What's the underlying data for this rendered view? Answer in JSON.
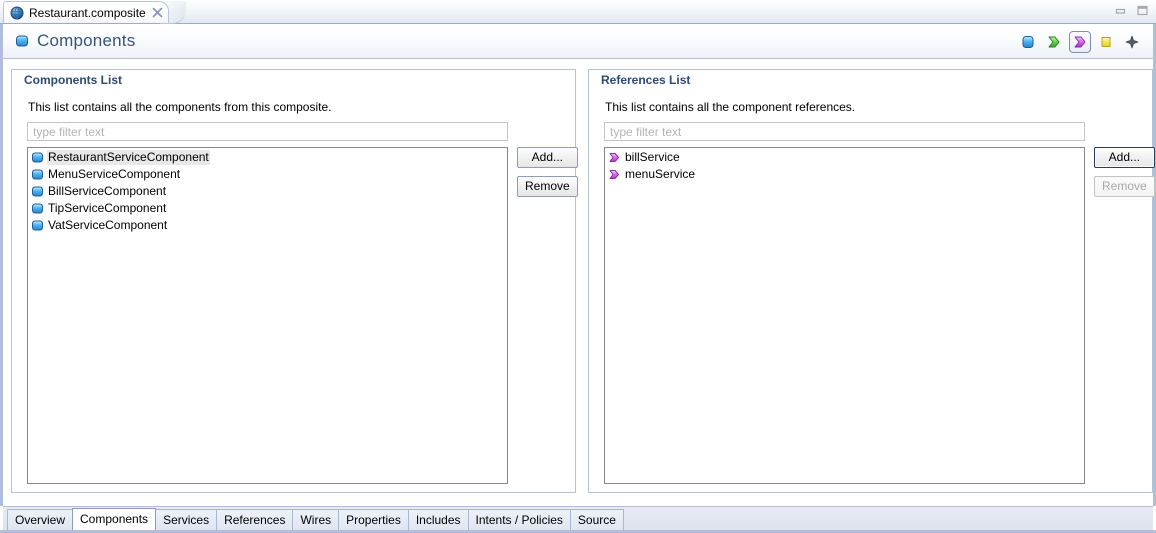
{
  "window": {
    "minimize_label": "Minimize",
    "maximize_label": "Maximize",
    "frame_color": "#b0bedb"
  },
  "editor_tab": {
    "title": "Restaurant.composite",
    "icon": "composite-globe-icon",
    "close_icon": "close-icon"
  },
  "form": {
    "title": "Components",
    "icon": "component-icon",
    "toolbar": [
      {
        "name": "component-tool",
        "icon": "component-icon",
        "color": "#3fa0e8",
        "selected": false
      },
      {
        "name": "service-tool",
        "icon": "service-chevron-icon",
        "color": "#58c845",
        "selected": false
      },
      {
        "name": "reference-tool",
        "icon": "reference-chevron-icon",
        "color": "#d45ce8",
        "selected": true
      },
      {
        "name": "property-tool",
        "icon": "property-square-icon",
        "color": "#f2e04a",
        "selected": false
      },
      {
        "name": "wire-tool",
        "icon": "wire-star-icon",
        "color": "#4a4a4a",
        "selected": false
      }
    ]
  },
  "components_section": {
    "title": "Components List",
    "description": "This list contains all the components from this composite.",
    "filter": {
      "value": "",
      "placeholder": "type filter text"
    },
    "items": [
      {
        "label": "RestaurantServiceComponent",
        "icon": "component-icon",
        "selected": true
      },
      {
        "label": "MenuServiceComponent",
        "icon": "component-icon",
        "selected": false
      },
      {
        "label": "BillServiceComponent",
        "icon": "component-icon",
        "selected": false
      },
      {
        "label": "TipServiceComponent",
        "icon": "component-icon",
        "selected": false
      },
      {
        "label": "VatServiceComponent",
        "icon": "component-icon",
        "selected": false
      }
    ],
    "add_label": "Add...",
    "remove_label": "Remove",
    "add_enabled": true,
    "remove_enabled": true
  },
  "references_section": {
    "title": "References List",
    "description": "This list contains all the component references.",
    "filter": {
      "value": "",
      "placeholder": "type filter text"
    },
    "items": [
      {
        "label": "billService",
        "icon": "reference-chevron-icon",
        "selected": false
      },
      {
        "label": "menuService",
        "icon": "reference-chevron-icon",
        "selected": false
      }
    ],
    "add_label": "Add...",
    "remove_label": "Remove",
    "add_enabled": true,
    "remove_enabled": false
  },
  "page_tabs": [
    {
      "label": "Overview",
      "active": false
    },
    {
      "label": "Components",
      "active": true
    },
    {
      "label": "Services",
      "active": false
    },
    {
      "label": "References",
      "active": false
    },
    {
      "label": "Wires",
      "active": false
    },
    {
      "label": "Properties",
      "active": false
    },
    {
      "label": "Includes",
      "active": false
    },
    {
      "label": "Intents / Policies",
      "active": false
    },
    {
      "label": "Source",
      "active": false
    }
  ]
}
